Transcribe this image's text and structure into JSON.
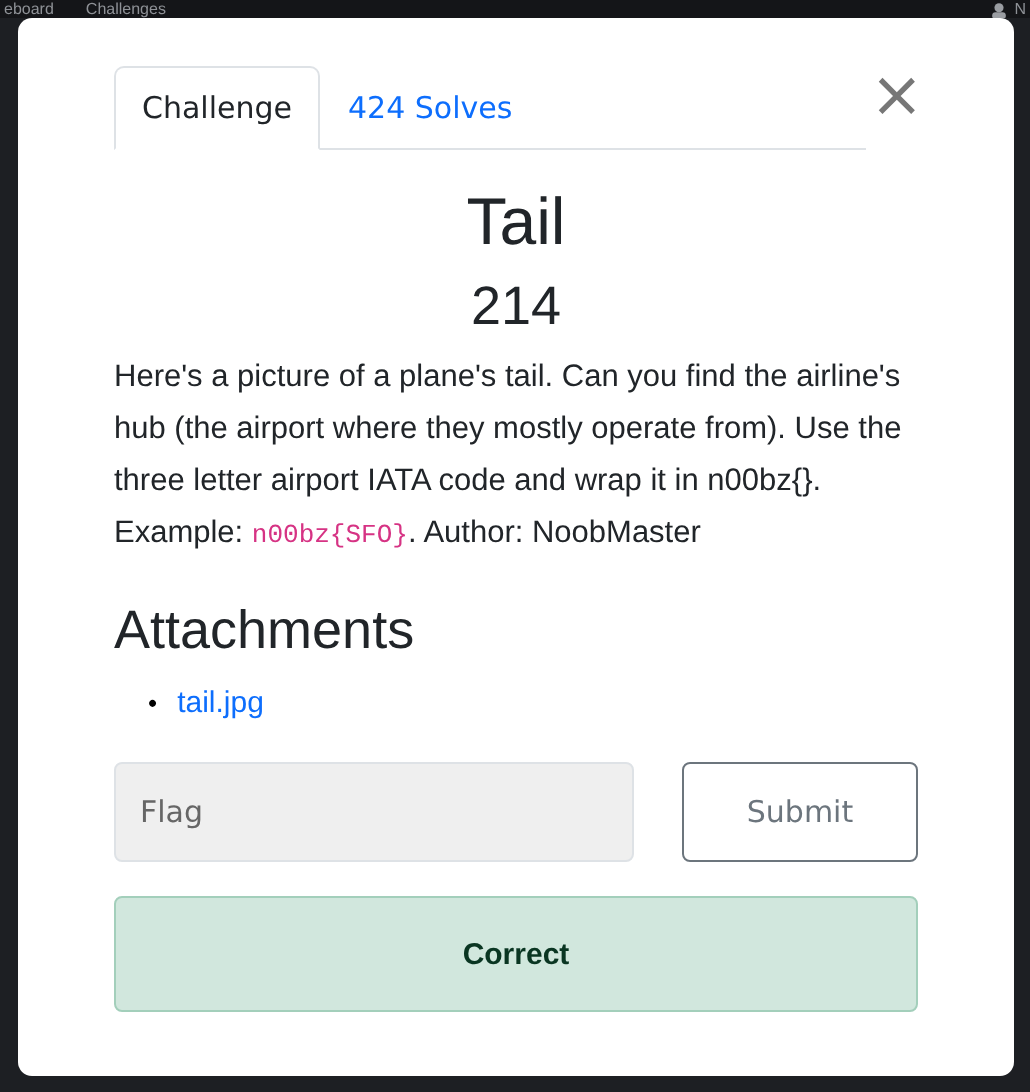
{
  "nav": {
    "items": [
      "eboard",
      "Challenges"
    ],
    "user": "N"
  },
  "modal": {
    "tabs": [
      {
        "label": "Challenge",
        "selected": true
      },
      {
        "label": "424 Solves",
        "selected": false
      }
    ],
    "close": "×",
    "title": "Tail",
    "points": "214",
    "description": {
      "text": "Here's a picture of a plane's tail. Can you find the airline's hub (the airport where they mostly operate from). Use the three letter airport IATA code and wrap it in n00bz{}. Example: ",
      "code": "n00bz{SFO}",
      "after": ". Author: NoobMaster"
    },
    "attachments": {
      "heading": "Attachments",
      "files": [
        "tail.jpg"
      ],
      "marker": "•"
    },
    "flag": {
      "placeholder": "Flag"
    },
    "submit": "Submit",
    "result": {
      "kind": "correct",
      "text": "Correct"
    }
  }
}
